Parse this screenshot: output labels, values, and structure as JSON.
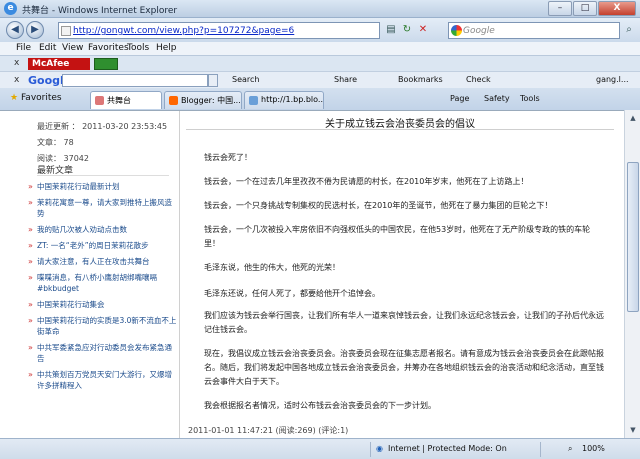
{
  "window": {
    "title": "共舞台 - Windows Internet Explorer",
    "min": "–",
    "max": "□",
    "close": "X"
  },
  "address": {
    "url": "http://gongwt.com/view.php?p=107272&page=6",
    "search_placeholder": "Google"
  },
  "menu": [
    "File",
    "Edit",
    "View",
    "Favorites",
    "Tools",
    "Help"
  ],
  "mcafee": {
    "close": "x",
    "label": "McAfee"
  },
  "google_bar": {
    "close": "x",
    "logo": "Google",
    "search": "Search",
    "share": "Share",
    "bookmarks": "Bookmarks",
    "check": "Check",
    "account": "gang.l..."
  },
  "tabs": {
    "favorites": "Favorites",
    "items": [
      {
        "label": "共舞台",
        "active": true
      },
      {
        "label": "Blogger: 中国...",
        "active": false
      },
      {
        "label": "http://1.bp.blo...",
        "active": false
      }
    ],
    "tools": [
      "Page",
      "Safety",
      "Tools"
    ]
  },
  "left": {
    "updated": "最近更新 ： 2011-03-20 23:53:45",
    "articles": "文章： 78",
    "reads": "阅读： 37042",
    "latest_heading": "最新文章",
    "latest": [
      "中国茉莉花行动最新计划",
      "茉莉花寓意一尊，请大家到推特上搬风造势",
      "我的贴几次被人劝动点击数",
      "ZT: 一名“老外”的周日茉莉花散步",
      "请大家注意，有人正在攻击共舞台",
      "喋喋消息，有八桥小鹰射胡绑嘴嚷嗝 #bkbudget",
      "中国茉莉花行动集会",
      "中国茉莉花行动的实质是3.0新不流血不上街革命",
      "中共军委紧急应对行动委员会发布紧急通告",
      "中共策划百万党员天安门大游行，又爆增许多拼精程入"
    ]
  },
  "article": {
    "title": "关于成立钱云会治丧委员会的倡议",
    "paragraphs": [
      "钱云会死了！",
      "钱云会，一个在过去几年里孜孜不倦为民请愿的村长，在2010年岁末，他死在了上访路上！",
      "钱云会，一个只身挑战专制集权的民选村长，在2010年的圣诞节，他死在了暴力集团的巨轮之下！",
      "钱云会，一个几次被投入牢房依旧不向强权低头的中国农民，在他53岁时，他死在了无产阶级专政的铁的车轮里！",
      "毛泽东说，他生的伟大，他死的光荣！",
      "毛泽东还说，任何人死了，都要给他开个追悼会。",
      "我们应该为钱云会举行国丧，让我们所有华人一道来哀悼钱云会，让我们永远纪念钱云会，让我们的子孙后代永远记住钱云会。",
      "现在，我倡议成立钱云会治丧委员会。治丧委员会现在征集志愿者报名。请有意成为钱云会治丧委员会在此跟帖报名。随后，我们将发起中国各地成立钱云会治丧委员会，并筹办在各地组织钱云会的治丧活动和纪念活动，直至钱云会事件大白于天下。",
      "我会根据报名者情况，适时公布钱云会治丧委员会的下一步计划。"
    ],
    "footer": "2011-01-01  11:47:21   (阅读:269)  (评论:1)"
  },
  "status": {
    "zone": "Internet | Protected Mode: On",
    "zoom": "100%"
  }
}
